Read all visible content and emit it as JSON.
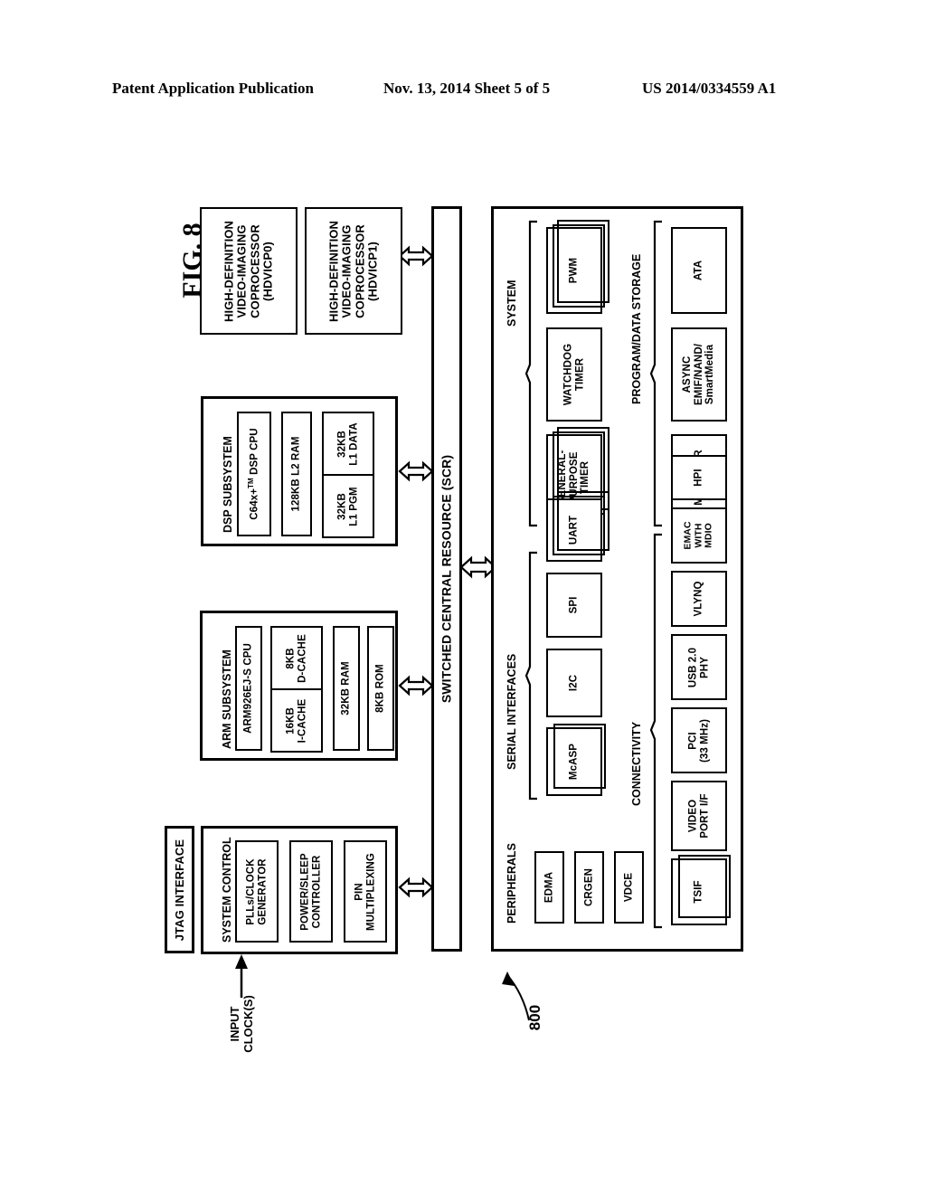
{
  "header": {
    "left": "Patent Application Publication",
    "middle": "Nov. 13, 2014  Sheet 5 of 5",
    "right": "US 2014/0334559 A1"
  },
  "figure": {
    "label": "FIG. 8",
    "reference_numeral": "800",
    "input_clock_label": "INPUT\nCLOCK(S)"
  },
  "scr": {
    "label": "SWITCHED CENTRAL RESOURCE (SCR)"
  },
  "coprocessors": [
    {
      "name": "hdvicp0",
      "label": "HIGH-DEFINITION\nVIDEO-IMAGING\nCOPROCESSOR\n(HDVICP0)"
    },
    {
      "name": "hdvicp1",
      "label": "HIGH-DEFINITION\nVIDEO-IMAGING\nCOPROCESSOR\n(HDVICP1)"
    }
  ],
  "dsp_subsystem": {
    "title": "DSP SUBSYSTEM",
    "cpu": "C64x+TM DSP CPU",
    "cpu_main": "C64x+",
    "cpu_tm": "TM",
    "cpu_tail": "DSP CPU",
    "l2ram": "128KB L2 RAM",
    "l1pgm": "32KB\nL1 PGM",
    "l1data": "32KB\nL1 DATA"
  },
  "arm_subsystem": {
    "title": "ARM SUBSYSTEM",
    "cpu": "ARM926EJ-S CPU",
    "icache": "16KB\nI-CACHE",
    "dcache": "8KB\nD-CACHE",
    "ram": "32KB RAM",
    "rom": "8KB ROM"
  },
  "jtag": {
    "label": "JTAG INTERFACE"
  },
  "system_control": {
    "title": "SYSTEM CONTROL",
    "items": [
      {
        "name": "plls-clock-generator",
        "label": "PLLs/CLOCK\nGENERATOR"
      },
      {
        "name": "power-sleep-controller",
        "label": "POWER/SLEEP\nCONTROLLER"
      },
      {
        "name": "pin-multiplexing",
        "label": "PIN\nMULTIPLEXING"
      }
    ]
  },
  "groups": {
    "system": {
      "label": "SYSTEM",
      "items": [
        {
          "name": "general-purpose-timer",
          "label": "GENERAL-\nPURPOSE\nTIMER",
          "stacked": true
        },
        {
          "name": "watchdog-timer",
          "label": "WATCHDOG\nTIMER",
          "stacked": false
        },
        {
          "name": "pwm",
          "label": "PWM",
          "stacked": true
        }
      ]
    },
    "program_data_storage": {
      "label": "PROGRAM/DATA STORAGE",
      "items": [
        {
          "name": "ddr2-mem-ctlr",
          "label": "DDR2\nMEM CTLR\n(16b/32b)",
          "stacked": false
        },
        {
          "name": "async-emif-nand-smartmedia",
          "label": "ASYNC\nEMIF/NAND/\nSmartMedia",
          "stacked": false
        },
        {
          "name": "ata",
          "label": "ATA",
          "stacked": false
        }
      ]
    },
    "serial_interfaces": {
      "label": "SERIAL INTERFACES",
      "items": [
        {
          "name": "mcasp",
          "label": "McASP",
          "stacked": "single"
        },
        {
          "name": "i2c",
          "label": "I2C",
          "stacked": false
        },
        {
          "name": "spi",
          "label": "SPI",
          "stacked": false
        },
        {
          "name": "uart",
          "label": "UART",
          "stacked": true
        }
      ]
    },
    "connectivity": {
      "label": "CONNECTIVITY",
      "items": [
        {
          "name": "tsif",
          "label": "TSIF",
          "stacked": "single"
        },
        {
          "name": "video-port-if",
          "label": "VIDEO\nPORT I/F",
          "stacked": false
        },
        {
          "name": "pci",
          "label": "PCI\n(33 MHz)",
          "stacked": false
        },
        {
          "name": "usb2-phy",
          "label": "USB 2.0\nPHY",
          "stacked": false
        },
        {
          "name": "vlynq",
          "label": "VLYNQ",
          "stacked": false
        },
        {
          "name": "emac-with-mdio",
          "label": "EMAC\nWITH\nMDIO",
          "stacked": false
        },
        {
          "name": "hpi",
          "label": "HPI",
          "stacked": false
        }
      ]
    },
    "peripherals": {
      "label": "PERIPHERALS",
      "items": [
        {
          "name": "edma",
          "label": "EDMA"
        },
        {
          "name": "crgen",
          "label": "CRGEN"
        },
        {
          "name": "vdce",
          "label": "VDCE"
        }
      ]
    }
  },
  "colors": {
    "ink": "#000000",
    "paper": "#ffffff"
  }
}
